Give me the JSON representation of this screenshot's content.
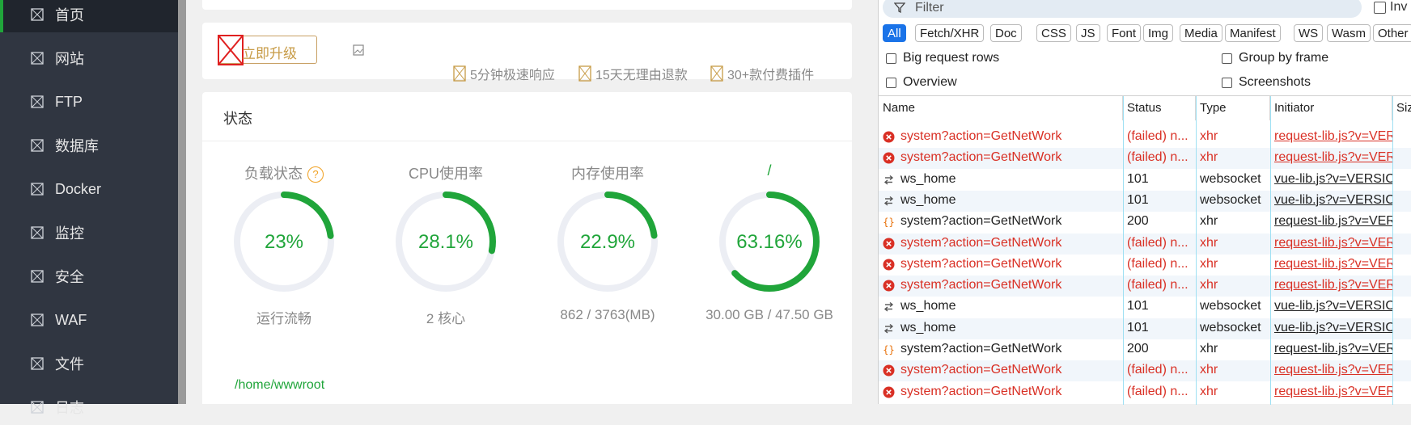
{
  "sidebar": {
    "items": [
      {
        "label": "首页",
        "active": true
      },
      {
        "label": "网站"
      },
      {
        "label": "FTP"
      },
      {
        "label": "数据库"
      },
      {
        "label": "Docker"
      },
      {
        "label": "监控"
      },
      {
        "label": "安全"
      },
      {
        "label": "WAF"
      },
      {
        "label": "文件"
      },
      {
        "label": "日志"
      }
    ]
  },
  "promo": {
    "upgrade_label": "立即升级",
    "features": [
      "5分钟极速响应",
      "15天无理由退款",
      "30+款付费插件"
    ]
  },
  "status": {
    "title": "状态",
    "gauges": [
      {
        "title": "负载状态",
        "value": "23%",
        "percent": 23,
        "sub": "运行流畅"
      },
      {
        "title": "CPU使用率",
        "value": "28.1%",
        "percent": 28.1,
        "sub": "2 核心"
      },
      {
        "title": "内存使用率",
        "value": "22.9%",
        "percent": 22.9,
        "sub": "862 / 3763(MB)"
      },
      {
        "title": "/",
        "value": "63.16%",
        "percent": 63.16,
        "sub": "30.00 GB / 47.50 GB"
      }
    ],
    "path": "/home/wwwroot"
  },
  "devtools": {
    "filter_placeholder": "Filter",
    "invert_label": "Inv",
    "type_filters": [
      "All",
      "Fetch/XHR",
      "Doc",
      "CSS",
      "JS",
      "Font",
      "Img",
      "Media",
      "Manifest",
      "WS",
      "Wasm",
      "Other"
    ],
    "options": {
      "big_rows": "Big request rows",
      "group_by_frame": "Group by frame",
      "overview": "Overview",
      "screenshots": "Screenshots"
    },
    "columns": [
      "Name",
      "Status",
      "Type",
      "Initiator",
      "Size"
    ],
    "rows": [
      {
        "name": "system?action=GetNetWork",
        "status": "(failed) n...",
        "type": "xhr",
        "initiator": "request-lib.js?v=VER",
        "kind": "failed"
      },
      {
        "name": "system?action=GetNetWork",
        "status": "(failed) n...",
        "type": "xhr",
        "initiator": "request-lib.js?v=VER",
        "kind": "failed"
      },
      {
        "name": "ws_home",
        "status": "101",
        "type": "websocket",
        "initiator": "vue-lib.js?v=VERSIO",
        "kind": "ws"
      },
      {
        "name": "ws_home",
        "status": "101",
        "type": "websocket",
        "initiator": "vue-lib.js?v=VERSIO",
        "kind": "ws"
      },
      {
        "name": "system?action=GetNetWork",
        "status": "200",
        "type": "xhr",
        "initiator": "request-lib.js?v=VER",
        "kind": "ok"
      },
      {
        "name": "system?action=GetNetWork",
        "status": "(failed) n...",
        "type": "xhr",
        "initiator": "request-lib.js?v=VER",
        "kind": "failed"
      },
      {
        "name": "system?action=GetNetWork",
        "status": "(failed) n...",
        "type": "xhr",
        "initiator": "request-lib.js?v=VER",
        "kind": "failed"
      },
      {
        "name": "system?action=GetNetWork",
        "status": "(failed) n...",
        "type": "xhr",
        "initiator": "request-lib.js?v=VER",
        "kind": "failed"
      },
      {
        "name": "ws_home",
        "status": "101",
        "type": "websocket",
        "initiator": "vue-lib.js?v=VERSIO",
        "kind": "ws"
      },
      {
        "name": "ws_home",
        "status": "101",
        "type": "websocket",
        "initiator": "vue-lib.js?v=VERSIO",
        "kind": "ws"
      },
      {
        "name": "system?action=GetNetWork",
        "status": "200",
        "type": "xhr",
        "initiator": "request-lib.js?v=VER",
        "kind": "ok"
      },
      {
        "name": "system?action=GetNetWork",
        "status": "(failed) n...",
        "type": "xhr",
        "initiator": "request-lib.js?v=VER",
        "kind": "failed"
      },
      {
        "name": "system?action=GetNetWork",
        "status": "(failed) n...",
        "type": "xhr",
        "initiator": "request-lib.js?v=VER",
        "kind": "failed"
      }
    ]
  },
  "colors": {
    "accent": "#20a53a",
    "sidebar_bg": "#303641",
    "error": "#d93025",
    "devtools_active": "#1a73e8"
  }
}
